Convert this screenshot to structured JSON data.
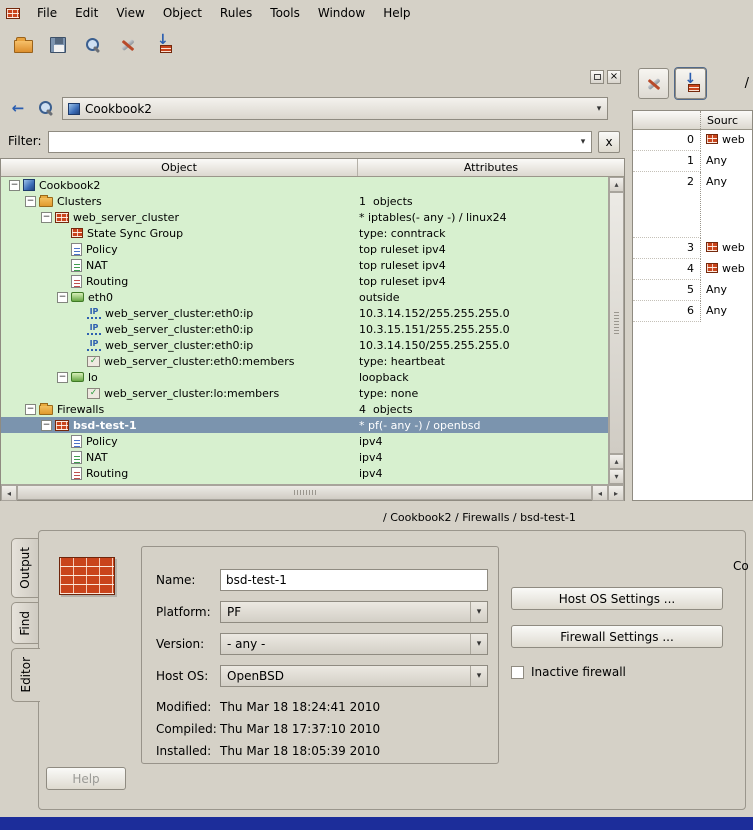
{
  "colors": {
    "selection": "#7b94ae",
    "tree_background": "#d7f0cf",
    "brick": "#c9441c",
    "taskbar": "#1c2d9a"
  },
  "menubar": {
    "items": [
      "File",
      "Edit",
      "View",
      "Object",
      "Rules",
      "Tools",
      "Window",
      "Help"
    ]
  },
  "toolbar": {
    "buttons": [
      {
        "name": "open-file",
        "icon": "open-icon"
      },
      {
        "name": "save",
        "icon": "floppy-icon"
      },
      {
        "name": "find",
        "icon": "magnifier-icon"
      },
      {
        "name": "compile",
        "icon": "wrench-icon"
      },
      {
        "name": "install",
        "icon": "install-icon"
      }
    ]
  },
  "left_panel": {
    "nav": {
      "combo_value": "Cookbook2"
    },
    "filter": {
      "label": "Filter:",
      "value": "",
      "clear_label": "x"
    },
    "tree": {
      "columns": [
        "Object",
        "Attributes"
      ],
      "rows": [
        {
          "depth": 0,
          "expander": true,
          "icon": "lib-icon",
          "label": "Cookbook2",
          "attr": ""
        },
        {
          "depth": 1,
          "expander": true,
          "icon": "folder-icon",
          "label": "Clusters",
          "attr": "1  objects"
        },
        {
          "depth": 2,
          "expander": true,
          "icon": "cluster-icon",
          "label": "web_server_cluster",
          "attr": "* iptables(- any -) / linux24"
        },
        {
          "depth": 3,
          "expander": false,
          "icon": "statesync-icon",
          "label": "State Sync Group",
          "attr": "type: conntrack"
        },
        {
          "depth": 3,
          "expander": false,
          "icon": "policy-icon",
          "label": "Policy",
          "attr": "top ruleset ipv4"
        },
        {
          "depth": 3,
          "expander": false,
          "icon": "nat-icon",
          "label": "NAT",
          "attr": "top ruleset ipv4"
        },
        {
          "depth": 3,
          "expander": false,
          "icon": "routing-icon",
          "label": "Routing",
          "attr": "top ruleset ipv4"
        },
        {
          "depth": 3,
          "expander": true,
          "icon": "iface-icon",
          "label": "eth0",
          "attr": "outside"
        },
        {
          "depth": 4,
          "expander": false,
          "icon": "ip-icon",
          "label": "web_server_cluster:eth0:ip",
          "attr": "10.3.14.152/255.255.255.0"
        },
        {
          "depth": 4,
          "expander": false,
          "icon": "ip-icon",
          "label": "web_server_cluster:eth0:ip",
          "attr": "10.3.15.151/255.255.255.0"
        },
        {
          "depth": 4,
          "expander": false,
          "icon": "ip-icon",
          "label": "web_server_cluster:eth0:ip",
          "attr": "10.3.14.150/255.255.255.0"
        },
        {
          "depth": 4,
          "expander": false,
          "icon": "members-icon",
          "label": "web_server_cluster:eth0:members",
          "attr": "type: heartbeat"
        },
        {
          "depth": 3,
          "expander": true,
          "icon": "iface-icon",
          "label": "lo",
          "attr": "loopback"
        },
        {
          "depth": 4,
          "expander": false,
          "icon": "members-icon",
          "label": "web_server_cluster:lo:members",
          "attr": "type: none"
        },
        {
          "depth": 1,
          "expander": true,
          "icon": "folder-icon",
          "label": "Firewalls",
          "attr": "4  objects"
        },
        {
          "depth": 2,
          "expander": true,
          "icon": "brick-icon",
          "label": "bsd-test-1",
          "attr": "* pf(- any -) / openbsd",
          "selected": true
        },
        {
          "depth": 3,
          "expander": false,
          "icon": "policy-icon",
          "label": "Policy",
          "attr": "ipv4"
        },
        {
          "depth": 3,
          "expander": false,
          "icon": "nat-icon",
          "label": "NAT",
          "attr": "ipv4"
        },
        {
          "depth": 3,
          "expander": false,
          "icon": "routing-icon",
          "label": "Routing",
          "attr": "ipv4"
        }
      ]
    }
  },
  "rules_panel": {
    "path_label": "/",
    "source_header": "Sourc",
    "rows": [
      {
        "num": "0",
        "icon": true,
        "label": "web",
        "tall": false
      },
      {
        "num": "1",
        "icon": false,
        "label": "Any",
        "tall": false
      },
      {
        "num": "2",
        "icon": false,
        "label": "Any",
        "tall": true
      },
      {
        "num": "3",
        "icon": true,
        "label": "web",
        "tall": false
      },
      {
        "num": "4",
        "icon": true,
        "label": "web",
        "tall": false
      },
      {
        "num": "5",
        "icon": false,
        "label": "Any",
        "tall": false
      },
      {
        "num": "6",
        "icon": false,
        "label": "Any",
        "tall": false
      }
    ]
  },
  "editor": {
    "breadcrumb": "/ Cookbook2 / Firewalls / bsd-test-1",
    "tabs": [
      "Output",
      "Find",
      "Editor"
    ],
    "active_tab": "Editor",
    "fields": {
      "name_label": "Name:",
      "name_value": "bsd-test-1",
      "platform_label": "Platform:",
      "platform_value": "PF",
      "version_label": "Version:",
      "version_value": "- any -",
      "hostos_label": "Host OS:",
      "hostos_value": "OpenBSD",
      "modified_label": "Modified:",
      "modified_value": "Thu Mar 18 18:24:41 2010",
      "compiled_label": "Compiled:",
      "compiled_value": "Thu Mar 18 17:37:10 2010",
      "installed_label": "Installed:",
      "installed_value": "Thu Mar 18 18:05:39 2010"
    },
    "buttons": {
      "host_os": "Host OS Settings ...",
      "firewall": "Firewall Settings ...",
      "help": "Help"
    },
    "inactive_checkbox": {
      "label": "Inactive firewall",
      "checked": false
    },
    "comment_label": "Co"
  }
}
